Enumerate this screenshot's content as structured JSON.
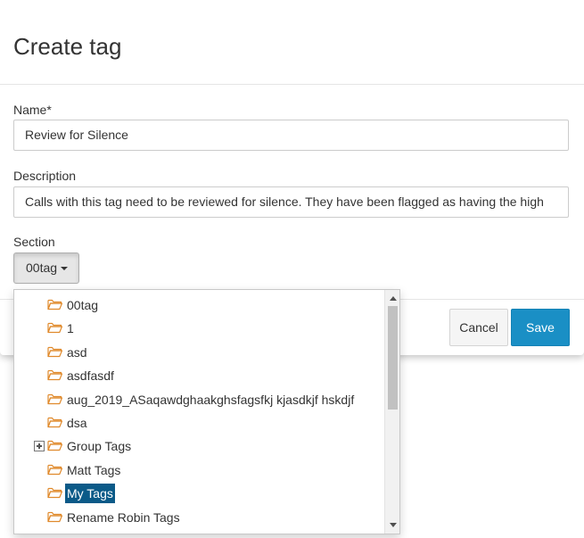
{
  "dialog": {
    "title": "Create tag",
    "name_label": "Name*",
    "name_value": "Review for Silence",
    "description_label": "Description",
    "description_value": "Calls with this tag need to be reviewed for silence. They have been flagged as having the high",
    "section_label": "Section",
    "section_value": "00tag",
    "cancel_label": "Cancel",
    "save_label": "Save",
    "save_color": "#1a8fc5"
  },
  "dropdown": {
    "items": [
      {
        "label": "00tag",
        "icon": "folder-open-icon",
        "expandable": false,
        "selected": false
      },
      {
        "label": "1",
        "icon": "folder-open-icon",
        "expandable": false,
        "selected": false
      },
      {
        "label": "asd",
        "icon": "folder-open-icon",
        "expandable": false,
        "selected": false
      },
      {
        "label": "asdfasdf",
        "icon": "folder-open-icon",
        "expandable": false,
        "selected": false
      },
      {
        "label": "aug_2019_ASaqawdghaakghsfagsfkj kjasdkjf hskdjf",
        "icon": "folder-open-icon",
        "expandable": false,
        "selected": false
      },
      {
        "label": "dsa",
        "icon": "folder-open-icon",
        "expandable": false,
        "selected": false
      },
      {
        "label": "Group Tags",
        "icon": "folder-open-icon",
        "expandable": true,
        "selected": false
      },
      {
        "label": "Matt Tags",
        "icon": "folder-open-icon",
        "expandable": false,
        "selected": false
      },
      {
        "label": "My Tags",
        "icon": "folder-open-icon",
        "expandable": false,
        "selected": true
      },
      {
        "label": "Rename Robin Tags",
        "icon": "folder-open-icon",
        "expandable": false,
        "selected": false
      }
    ],
    "folder_color": "#e08a2c",
    "selected_color": "#0b5a88"
  }
}
